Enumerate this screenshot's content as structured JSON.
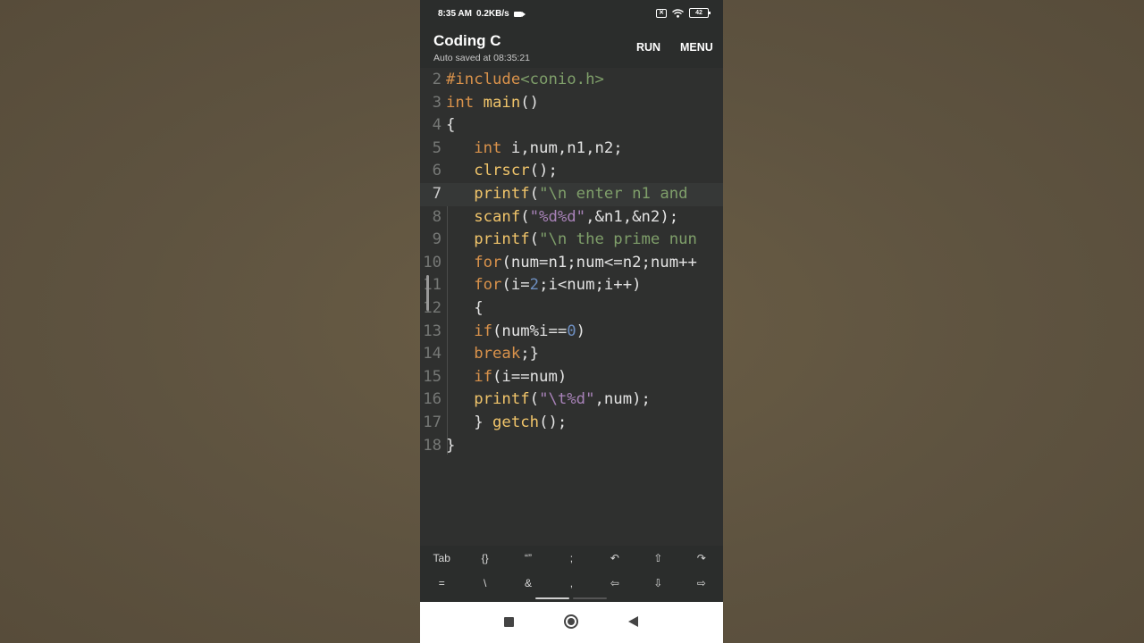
{
  "status_bar": {
    "time": "8:35 AM",
    "speed": "0.2KB/s",
    "battery": "42",
    "icons": [
      "camera-icon",
      "sim-off-icon",
      "wifi-icon",
      "battery-icon"
    ]
  },
  "app_bar": {
    "title": "Coding C",
    "subtitle": "Auto saved at 08:35:21",
    "run_label": "RUN",
    "menu_label": "MENU"
  },
  "editor": {
    "active_line": "7",
    "lines": [
      {
        "no": "2",
        "text": "#include<conio.h>"
      },
      {
        "no": "3",
        "text": "int main()"
      },
      {
        "no": "4",
        "text": "{"
      },
      {
        "no": "5",
        "text": "   int i,num,n1,n2;"
      },
      {
        "no": "6",
        "text": "   clrscr();"
      },
      {
        "no": "7",
        "text": "   printf(\"\\n enter n1 and"
      },
      {
        "no": "8",
        "text": "   scanf(\"%d%d\",&n1,&n2);"
      },
      {
        "no": "9",
        "text": "   printf(\"\\n the prime nun"
      },
      {
        "no": "10",
        "text": "   for(num=n1;num<=n2;num++"
      },
      {
        "no": "11",
        "text": "   for(i=2;i<num;i++)"
      },
      {
        "no": "12",
        "text": "   {"
      },
      {
        "no": "13",
        "text": "   if(num%i==0)"
      },
      {
        "no": "14",
        "text": "   break;}"
      },
      {
        "no": "15",
        "text": "   if(i==num)"
      },
      {
        "no": "16",
        "text": "   printf(\"\\t%d\",num);"
      },
      {
        "no": "17",
        "text": "   } getch();"
      },
      {
        "no": "18",
        "text": "}"
      }
    ]
  },
  "symbols": {
    "row1": [
      "Tab",
      "{}",
      "“”",
      ";",
      "↶",
      "⇧",
      "↷"
    ],
    "row2": [
      "=",
      "\\",
      "&",
      ",",
      "⇦",
      "⇩",
      "⇨"
    ]
  },
  "navigation": [
    "recent-apps",
    "home",
    "back"
  ]
}
